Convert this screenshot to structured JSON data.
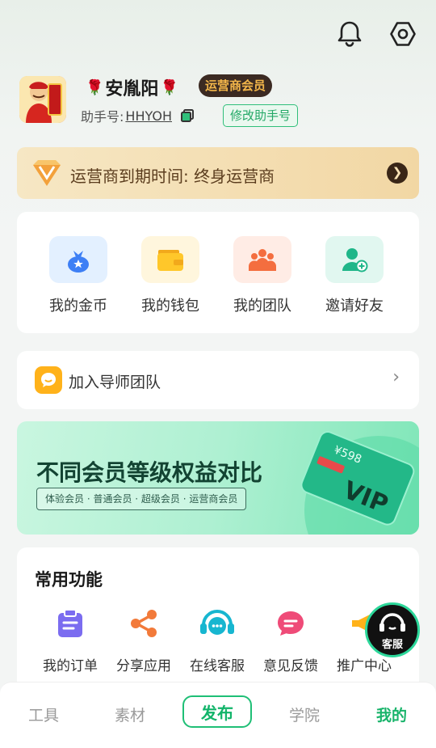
{
  "header": {
    "icons": [
      "bell-icon",
      "settings-icon"
    ]
  },
  "profile": {
    "name": "安胤阳",
    "name_decoration": "🌹",
    "badge": "运营商会员",
    "assistant_label": "助手号:",
    "assistant_id": "HHYOH",
    "modify_button": "修改助手号"
  },
  "expire": {
    "text": "运营商到期时间: 终身运营商",
    "arrow": "❯"
  },
  "quick": [
    {
      "label": "我的金币"
    },
    {
      "label": "我的钱包"
    },
    {
      "label": "我的团队"
    },
    {
      "label": "邀请好友"
    }
  ],
  "mentor": {
    "label": "加入导师团队"
  },
  "banner": {
    "title": "不同会员等级权益对比",
    "subtitle": "体验会员 · 普通会员 · 超级会员 · 运营商会员",
    "card_price": "¥598",
    "card_text": "VIP"
  },
  "functions": {
    "title": "常用功能",
    "items": [
      {
        "label": "我的订单"
      },
      {
        "label": "分享应用"
      },
      {
        "label": "在线客服"
      },
      {
        "label": "意见反馈"
      },
      {
        "label": "推广中心"
      }
    ]
  },
  "floating_service": {
    "label": "客服"
  },
  "tabs": {
    "tool": "工具",
    "material": "素材",
    "publish": "发布",
    "academy": "学院",
    "mine": "我的"
  },
  "colors": {
    "accent": "#19b46b",
    "gold": "#f3b64a",
    "banner": "#aef0d2"
  }
}
